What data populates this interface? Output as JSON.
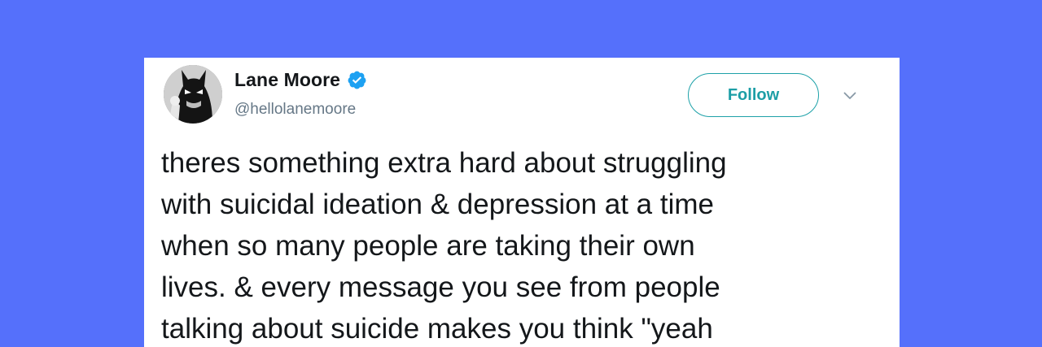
{
  "colors": {
    "background": "#5570fb",
    "card": "#ffffff",
    "accent": "#1d9ea6",
    "verified": "#1da1f2",
    "text_primary": "#14171a",
    "text_secondary": "#657786"
  },
  "tweet": {
    "author": {
      "display_name": "Lane Moore",
      "handle": "@hellolanemoore",
      "verified_icon": "verified-badge-icon",
      "avatar_icon": "avatar"
    },
    "actions": {
      "follow_label": "Follow",
      "more_icon": "chevron-down-icon"
    },
    "text_lines": [
      "theres something extra hard about struggling",
      "with suicidal ideation & depression at a time",
      "when so many people are taking their own",
      "lives. & every message you see from people",
      "talking about suicide makes you think \"yeah",
      ""
    ]
  }
}
